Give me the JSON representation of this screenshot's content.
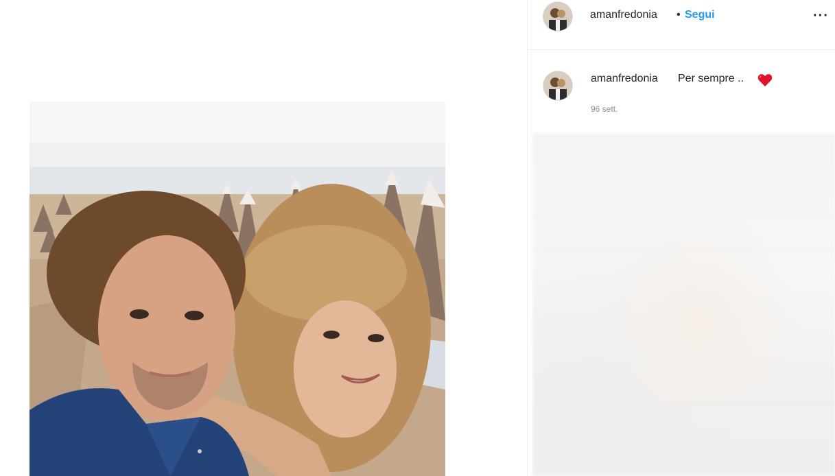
{
  "post": {
    "photo_icon": "photo"
  },
  "header": {
    "username": "amanfredonia",
    "separator": "•",
    "follow_label": "Segui",
    "more_label": "···"
  },
  "comment": {
    "username": "amanfredonia",
    "text": "Per sempre ..",
    "emoji_icon": "red-heart-icon",
    "timestamp": "96 sett."
  },
  "colors": {
    "follow_blue": "#1f9bee",
    "heart_red": "#e0142b",
    "text_dark": "#262626",
    "text_muted": "#8e8e8e"
  }
}
